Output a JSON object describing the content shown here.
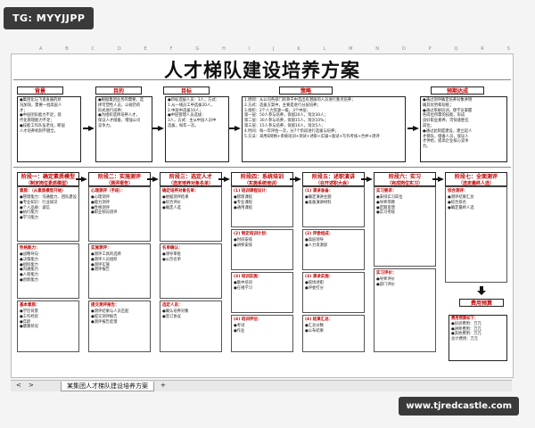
{
  "watermark_top": "TG: MYYJJPP",
  "watermark_bottom": "www.tjredcastle.com",
  "ruler_letters": [
    "A",
    "B",
    "C",
    "D",
    "E",
    "F",
    "G",
    "H",
    "I",
    "J",
    "K",
    "L",
    "M",
    "N",
    "O",
    "P",
    "Q",
    "R",
    "S"
  ],
  "title": "人才梯队建设培养方案",
  "top_headers": [
    "背景",
    "目的",
    "目标",
    "策略",
    "预期达成"
  ],
  "top_texts": {
    "background": [
      "●集团化与飞速发展的状",
      "况加快，需要一批高层人",
      "才；",
      "●中层团队能力不足，现",
      "代化管理能力不足；",
      "●技能工作队伍老化，断层",
      "人才培养机制不健全。"
    ],
    "purpose": [
      "●根据集团业务的需要，选",
      "择可塑性人员，以规范的",
      "形式进行培养；",
      "●为组织选择培养人才，",
      "保证人才储备，增强公司",
      "竞争力。"
    ],
    "target": [
      "●目标选拔人员：3人，方式：",
      "1.从一线员工中选拔20人，",
      "2.中层中选拔10人；",
      "●中层管理人员选拔：",
      "3人，方式：主从中层人员中",
      "选拔，每年一次。"
    ],
    "strategy": [
      "1.原则：从公司各部门的骨干中选出有潜质的人员进行重点培养；",
      "2.方式：选拔方案中，主要是进行分层培养；",
      "3.组织：2个人力资源一级，3个中层；",
      "  第一层：50人参与培养，保留20人，淘汰30人；",
      "  第二层：30人参与培养，保留15人，淘汰10%；",
      "  第三层：15人参与培养，保留10人，淘汰5人；",
      "4.时间：每一年评估一次，分7个阶段进行选拔与培养；",
      "5.方法：采用E网络+系统培训+测试+述职+实操+面试+写作考核+合并+测评"
    ],
    "expected": [
      "●通过测评确定培养对象并明",
      "确其优势和短板；",
      "●通过系统培训，使学员掌握",
      "各岗位所需的技能，形成",
      "良好职业素养，可快速胜任",
      "岗位；",
      "●通过此制度建设，建立起人",
      "才梯队，储备人员，保证人",
      "才供给，提高企业核心竞争",
      "力。"
    ]
  },
  "stages": [
    {
      "title": "阶段一：确定素质模型",
      "sub": "（制定岗位素质模型）"
    },
    {
      "title": "阶段二：实施测评",
      "sub": "（测评报告）"
    },
    {
      "title": "阶段三：选定人才",
      "sub": "（选定培养对象名单）"
    },
    {
      "title": "阶段四：系统培训",
      "sub": "（实施系统培训）"
    },
    {
      "title": "阶段五：述职演讲",
      "sub": "（召开述职大会）"
    },
    {
      "title": "阶段六：实习",
      "sub": "（完成岗位实习）"
    },
    {
      "title": "阶段七：全面测评",
      "sub": "（选定最终人选）"
    }
  ],
  "col1_cards": [
    {
      "title": "素质：（从素质模型开始）",
      "lines": [
        "●管理能力：沟通能力、团队建设",
        "●专业知识：行业知识",
        "●个人品质：诚信",
        "●执行能力",
        "●学习能力"
      ]
    },
    {
      "title": "性格能力：",
      "lines": [
        "●战略导向",
        "●决策能力",
        "●组织能力",
        "●沟通能力",
        "●人际能力",
        "●创新能力"
      ]
    },
    {
      "title": "基本素质：",
      "lines": [
        "●学历背景",
        "●工作经验",
        "●年龄",
        "●健康状况"
      ]
    }
  ],
  "col2_cards": [
    {
      "title": "心理测评（手段）：",
      "lines": [
        "●心理测评",
        "●能力测评",
        "●性格测评",
        "●职业倾向测评"
      ]
    },
    {
      "title": "实施测评：",
      "lines": [
        "●测评工具的选择",
        "●测评人员组织",
        "●测评实施",
        "●测评报告"
      ]
    },
    {
      "title": "提交测评报告：",
      "lines": [
        "●测评结果与人员匹配",
        "●提交测评报告",
        "●测评报告反馈"
      ]
    }
  ],
  "col3_cards": [
    {
      "title": "确定培养对象名单：",
      "lines": [
        "●依据测评结果",
        "●综合评价",
        "●确定人选"
      ]
    },
    {
      "title": "名单确认：",
      "lines": [
        "●领导审批",
        "●公示名单"
      ]
    },
    {
      "title": "选定人员：",
      "lines": [
        "●确认培养对象",
        "●签订协议"
      ]
    }
  ],
  "col4_cards": [
    {
      "title": "(1) 培训课程设计：",
      "lines": [
        "●管理课程",
        "●专业课程",
        "●通用课程"
      ]
    },
    {
      "title": "(2) 制定培训计划：",
      "lines": [
        "●时间安排",
        "●讲师安排"
      ]
    },
    {
      "title": "(3) 培训实施：",
      "lines": [
        "●集中培训",
        "●在线学习"
      ]
    },
    {
      "title": "(4) 培训评估：",
      "lines": [
        "●考试",
        "●作业"
      ]
    }
  ],
  "col5_cards": [
    {
      "title": "(1) 演讲准备：",
      "lines": [
        "●确定演讲主题",
        "●准备演讲材料"
      ]
    },
    {
      "title": "(2) 评委组成：",
      "lines": [
        "●高层领导",
        "●人力资源部"
      ]
    },
    {
      "title": "(3) 演讲实施：",
      "lines": [
        "●现场述职",
        "●评委打分"
      ]
    },
    {
      "title": "(4) 结果汇总：",
      "lines": [
        "●汇总分数",
        "●公布结果"
      ]
    }
  ],
  "col6_cards": [
    {
      "title": "实习要求：",
      "lines": [
        "●安排实习岗位",
        "●导师带教",
        "●定期反馈",
        "●实习考核"
      ]
    },
    {
      "title": "实习评价：",
      "lines": [
        "●导师评价",
        "●部门评价"
      ]
    }
  ],
  "col7_cards": [
    {
      "title": "综合测评：",
      "lines": [
        "●测评结果汇总",
        "●综合排名",
        "●确定最终人选"
      ]
    }
  ],
  "budget_title": "费用预算",
  "budget_box_title": "费用预算如下：",
  "budget_lines": [
    "●培训费用：万元",
    "●讲师费用：万元",
    "●其他费用：万元",
    "总计费用：万元"
  ],
  "sheet_tab": "某集团人才梯队建设培养方案",
  "tab_nav": [
    "<",
    ">",
    "+"
  ]
}
